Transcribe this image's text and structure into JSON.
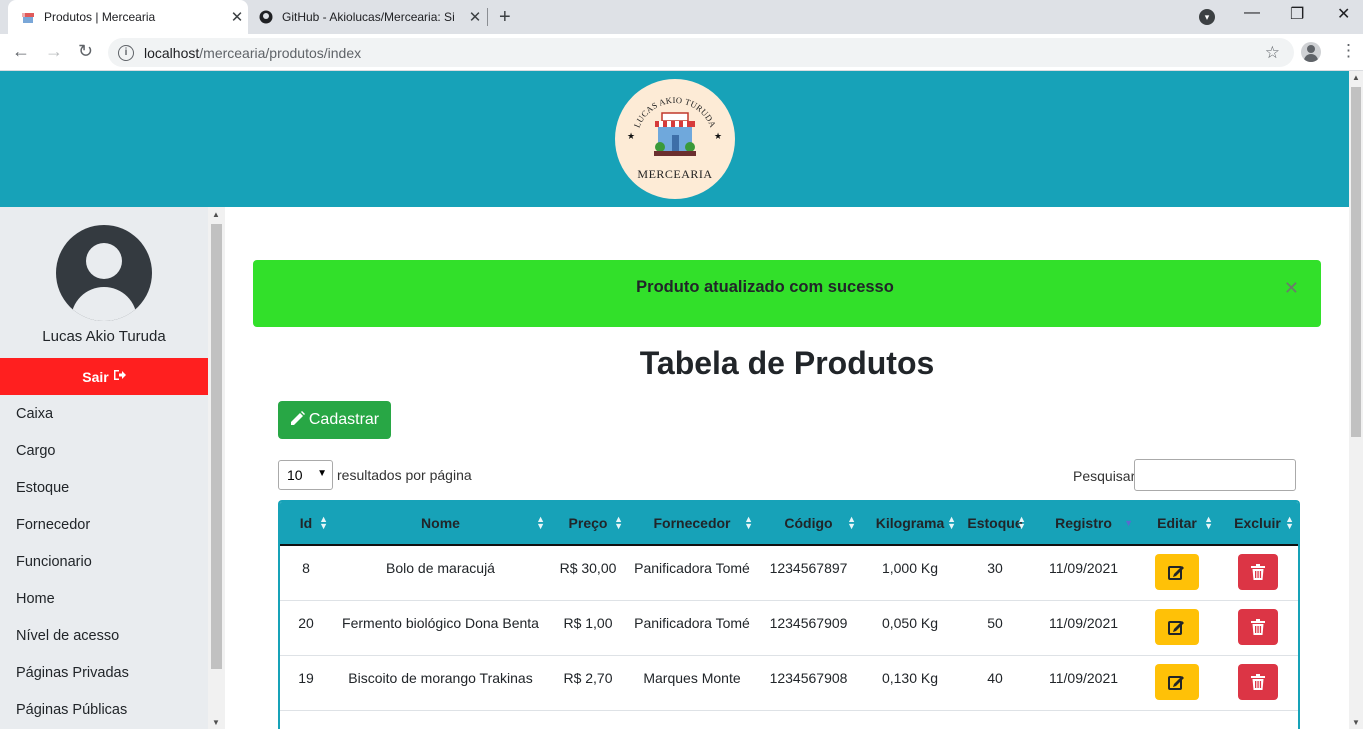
{
  "browser": {
    "tabs": [
      {
        "title": "Produtos | Mercearia",
        "active": true
      },
      {
        "title": "GitHub - Akiolucas/Mercearia: Si",
        "active": false
      }
    ],
    "url_host": "localhost",
    "url_path": "/mercearia/produtos/index"
  },
  "header": {
    "logo_arc_text": "LUCAS AKIO TURUDA",
    "logo_text": "MERCEARIA"
  },
  "sidebar": {
    "user_name": "Lucas Akio Turuda",
    "logout_label": "Sair",
    "items": [
      "Caixa",
      "Cargo",
      "Estoque",
      "Fornecedor",
      "Funcionario",
      "Home",
      "Nível de acesso",
      "Páginas Privadas",
      "Páginas Públicas"
    ]
  },
  "alert": {
    "message": "Produto atualizado com sucesso",
    "color": "#32e02a"
  },
  "main": {
    "title": "Tabela de Produtos",
    "create_button": "Cadastrar",
    "page_length": "10",
    "page_length_label": "resultados por página",
    "search_label": "Pesquisar",
    "search_value": ""
  },
  "table": {
    "columns": [
      "Id",
      "Nome",
      "Preço",
      "Fornecedor",
      "Código",
      "Kilograma",
      "Estoque",
      "Registro",
      "Editar",
      "Excluir"
    ],
    "rows": [
      {
        "id": "8",
        "nome": "Bolo de maracujá",
        "preco": "R$ 30,00",
        "fornecedor": "Panificadora Tomé",
        "codigo": "1234567897",
        "kilograma": "1,000 Kg",
        "estoque": "30",
        "registro": "11/09/2021"
      },
      {
        "id": "20",
        "nome": "Fermento biológico Dona Benta",
        "preco": "R$ 1,00",
        "fornecedor": "Panificadora Tomé",
        "codigo": "1234567909",
        "kilograma": "0,050 Kg",
        "estoque": "50",
        "registro": "11/09/2021"
      },
      {
        "id": "19",
        "nome": "Biscoito de morango Trakinas",
        "preco": "R$ 2,70",
        "fornecedor": "Marques Monte",
        "codigo": "1234567908",
        "kilograma": "0,130 Kg",
        "estoque": "40",
        "registro": "11/09/2021"
      }
    ]
  },
  "colors": {
    "header": "#17a2b8",
    "logout": "#ff1f1f",
    "create": "#28a745",
    "edit": "#ffc107",
    "delete": "#dc3545"
  }
}
